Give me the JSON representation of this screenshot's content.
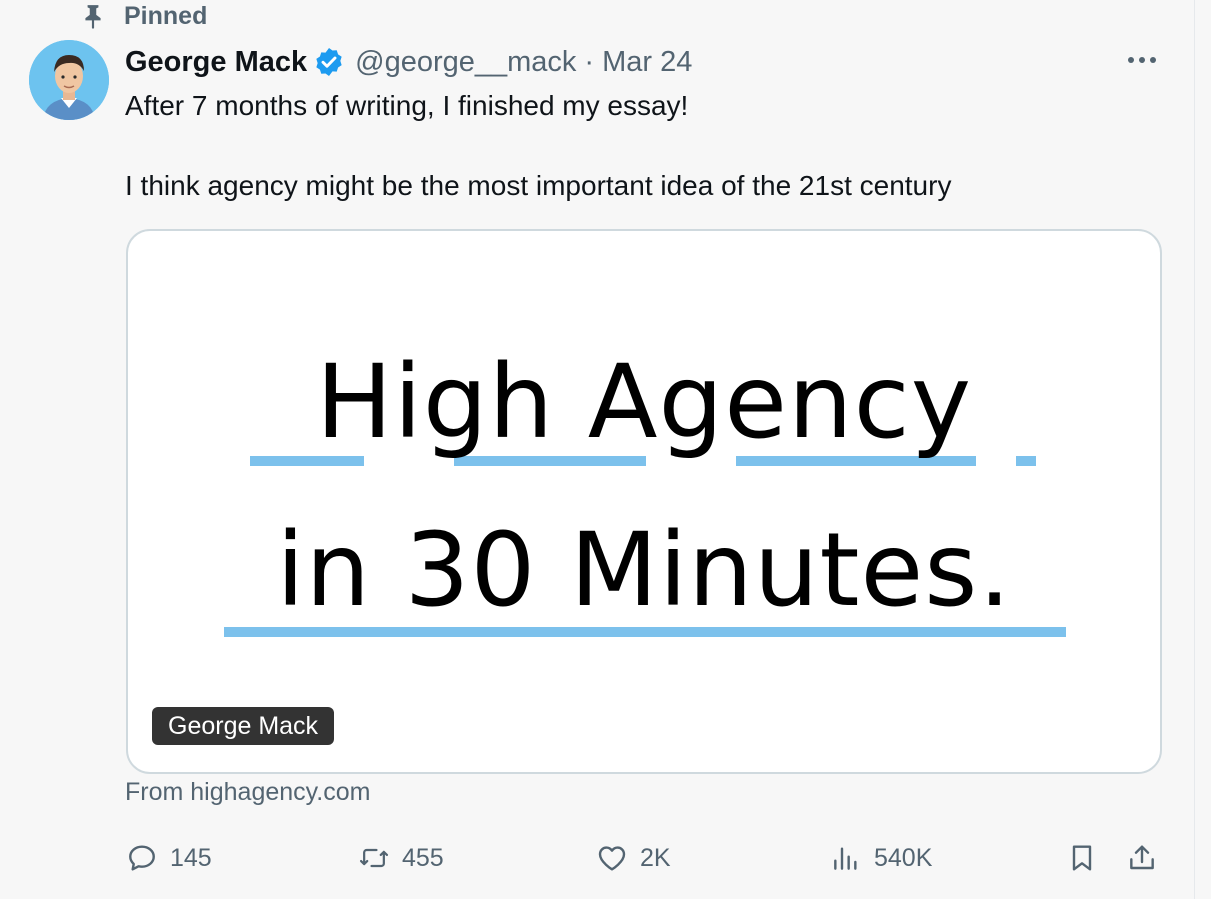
{
  "pinned": {
    "label": "Pinned",
    "icon": "pin-icon"
  },
  "author": {
    "name": "George Mack",
    "handle": "@george__mack",
    "separator": "·",
    "date": "Mar 24",
    "verified_icon": "verified-badge-icon"
  },
  "tweet": {
    "line1": "After 7 months of writing, I finished my essay!",
    "line2": "I think agency might be the most important idea of the 21st century"
  },
  "card": {
    "line1": "High Agency",
    "line2": "in 30 Minutes.",
    "badge": "George Mack",
    "source": "From highagency.com",
    "accent": "#7cc1ec"
  },
  "actions": {
    "replies": "145",
    "reposts": "455",
    "likes": "2K",
    "views": "540K"
  },
  "colors": {
    "background": "#f7f7f7",
    "text": "#0f1419",
    "muted": "#536471",
    "verified": "#1d9bf0"
  }
}
